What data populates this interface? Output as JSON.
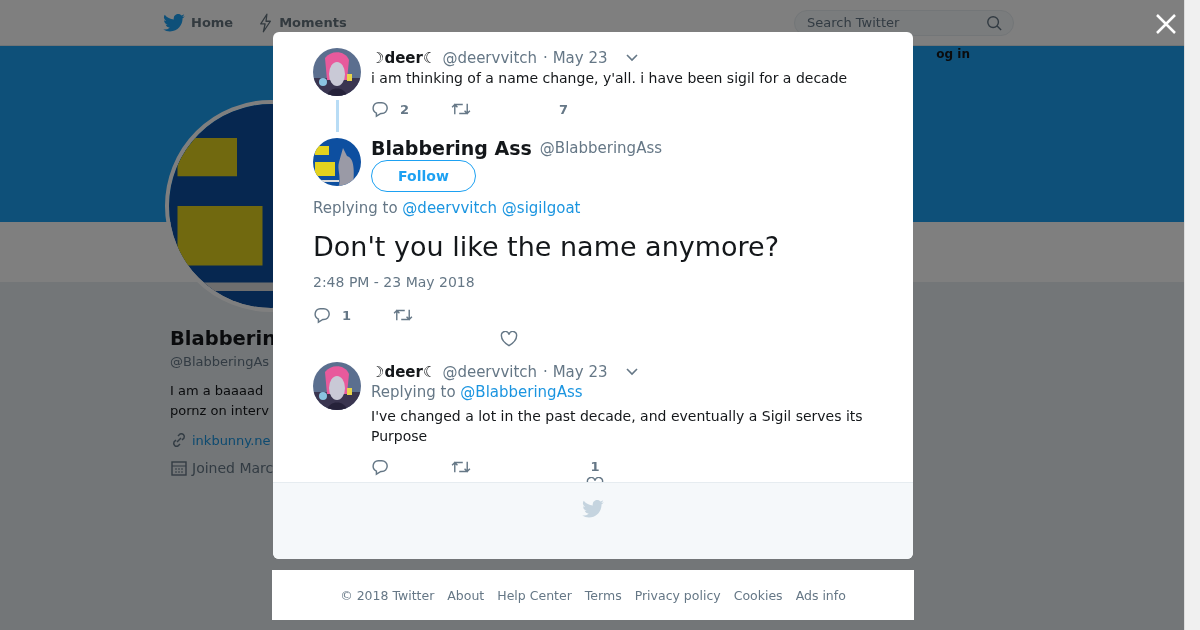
{
  "nav": {
    "items": [
      {
        "label": "Home"
      },
      {
        "label": "Moments"
      }
    ],
    "search": {
      "placeholder": "Search Twitter"
    },
    "login": "og in"
  },
  "profile": {
    "name": "Blabberin",
    "handle": "@BlabberingAs",
    "bio": [
      "I am a baaaad",
      "pornz on interv"
    ],
    "link": "inkbunny.ne",
    "joined": "Joined Marc"
  },
  "modal": {
    "parent": {
      "name": "☽deer☾",
      "handle": "@deervvitch",
      "time": "· May 23",
      "text": "i am thinking of a name change, y'all. i have been sigil for a decade",
      "reply_count": "2",
      "like_count": "7"
    },
    "focus": {
      "name": "Blabbering Ass",
      "handle": "@BlabberingAss",
      "follow": "Follow",
      "replying_label": "Replying to",
      "mentions": [
        "@deervvitch",
        "@sigilgoat"
      ],
      "text": "Don't you like the name anymore?",
      "timestamp": "2:48 PM - 23 May 2018",
      "reply_count": "1"
    },
    "replies": [
      {
        "name": "☽deer☾",
        "handle": "@deervvitch",
        "time": "· May 23",
        "replying_label": "Replying to",
        "mentions": [
          "@BlabberingAss"
        ],
        "text": "I've changed a lot in the past decade, and eventually a Sigil serves its Purpose",
        "like_count": "1"
      }
    ]
  },
  "footer": {
    "links": [
      "© 2018 Twitter",
      "About",
      "Help Center",
      "Terms",
      "Privacy policy",
      "Cookies",
      "Ads info"
    ]
  }
}
